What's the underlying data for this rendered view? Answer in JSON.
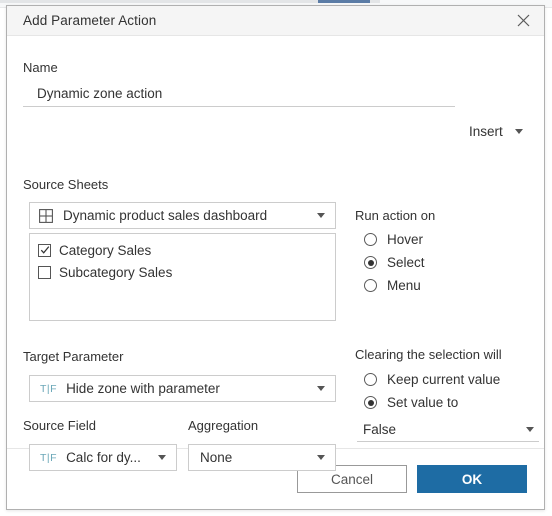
{
  "dialog": {
    "title": "Add Parameter Action",
    "close_icon": "close-icon"
  },
  "name_section": {
    "label": "Name",
    "value": "Dynamic zone action",
    "placeholder": "",
    "insert_label": "Insert"
  },
  "source_sheets": {
    "label": "Source Sheets",
    "selected_sheet": "Dynamic product sales dashboard",
    "sheet_icon": "dashboard-grid-icon",
    "items": [
      {
        "label": "Category Sales",
        "checked": true
      },
      {
        "label": "Subcategory Sales",
        "checked": false
      }
    ]
  },
  "run_action_on": {
    "label": "Run action on",
    "options": [
      {
        "label": "Hover",
        "selected": false
      },
      {
        "label": "Select",
        "selected": true
      },
      {
        "label": "Menu",
        "selected": false
      }
    ]
  },
  "target_parameter": {
    "label": "Target Parameter",
    "type_icon": "T|F",
    "value": "Hide zone with parameter"
  },
  "source_field": {
    "label": "Source Field",
    "type_icon": "T|F",
    "value": "Calc for dy..."
  },
  "aggregation": {
    "label": "Aggregation",
    "value": "None"
  },
  "clearing_selection": {
    "label": "Clearing the selection will",
    "options": [
      {
        "label": "Keep current value",
        "selected": false
      },
      {
        "label": "Set value to",
        "selected": true
      }
    ],
    "value": "False"
  },
  "footer": {
    "cancel_label": "Cancel",
    "ok_label": "OK"
  },
  "colors": {
    "accent": "#1e6ca4",
    "boolean_field": "#6ba7b8",
    "titlebar": "#f5f5f5",
    "border": "#cccccc"
  }
}
